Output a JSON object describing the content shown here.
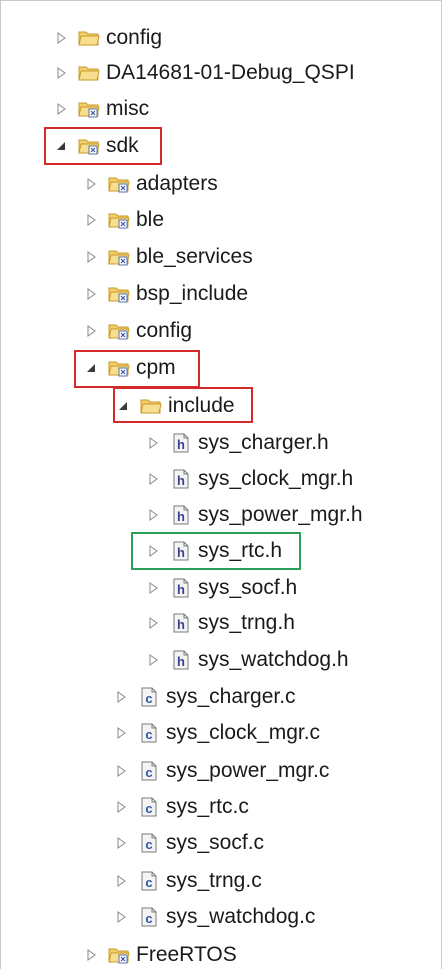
{
  "tree": {
    "items": [
      {
        "label": "config",
        "icon": "folder-icon",
        "state": "collapsed"
      },
      {
        "label": "DA14681-01-Debug_QSPI",
        "icon": "folder-icon",
        "state": "collapsed"
      },
      {
        "label": "misc",
        "icon": "source-folder-icon",
        "state": "collapsed"
      },
      {
        "label": "sdk",
        "icon": "source-folder-icon",
        "state": "expanded"
      },
      {
        "label": "adapters",
        "icon": "source-folder-icon",
        "state": "collapsed"
      },
      {
        "label": "ble",
        "icon": "source-folder-icon",
        "state": "collapsed"
      },
      {
        "label": "ble_services",
        "icon": "source-folder-icon",
        "state": "collapsed"
      },
      {
        "label": "bsp_include",
        "icon": "source-folder-icon",
        "state": "collapsed"
      },
      {
        "label": "config",
        "icon": "source-folder-icon",
        "state": "collapsed"
      },
      {
        "label": "cpm",
        "icon": "source-folder-icon",
        "state": "expanded"
      },
      {
        "label": "include",
        "icon": "folder-icon",
        "state": "expanded"
      },
      {
        "label": "sys_charger.h",
        "icon": "header-file-icon",
        "state": "collapsed"
      },
      {
        "label": "sys_clock_mgr.h",
        "icon": "header-file-icon",
        "state": "collapsed"
      },
      {
        "label": "sys_power_mgr.h",
        "icon": "header-file-icon",
        "state": "collapsed"
      },
      {
        "label": "sys_rtc.h",
        "icon": "header-file-icon",
        "state": "collapsed"
      },
      {
        "label": "sys_socf.h",
        "icon": "header-file-icon",
        "state": "collapsed"
      },
      {
        "label": "sys_trng.h",
        "icon": "header-file-icon",
        "state": "collapsed"
      },
      {
        "label": "sys_watchdog.h",
        "icon": "header-file-icon",
        "state": "collapsed"
      },
      {
        "label": "sys_charger.c",
        "icon": "c-file-icon",
        "state": "collapsed"
      },
      {
        "label": "sys_clock_mgr.c",
        "icon": "c-file-icon",
        "state": "collapsed"
      },
      {
        "label": "sys_power_mgr.c",
        "icon": "c-file-icon",
        "state": "collapsed"
      },
      {
        "label": "sys_rtc.c",
        "icon": "c-file-icon",
        "state": "collapsed"
      },
      {
        "label": "sys_socf.c",
        "icon": "c-file-icon",
        "state": "collapsed"
      },
      {
        "label": "sys_trng.c",
        "icon": "c-file-icon",
        "state": "collapsed"
      },
      {
        "label": "sys_watchdog.c",
        "icon": "c-file-icon",
        "state": "collapsed"
      },
      {
        "label": "FreeRTOS",
        "icon": "source-folder-icon",
        "state": "collapsed"
      }
    ]
  },
  "highlights": {
    "red_color": "#d42a2a",
    "green_color": "#2aa05a"
  },
  "icon_letters": {
    "header": "h",
    "c_source": "c"
  }
}
